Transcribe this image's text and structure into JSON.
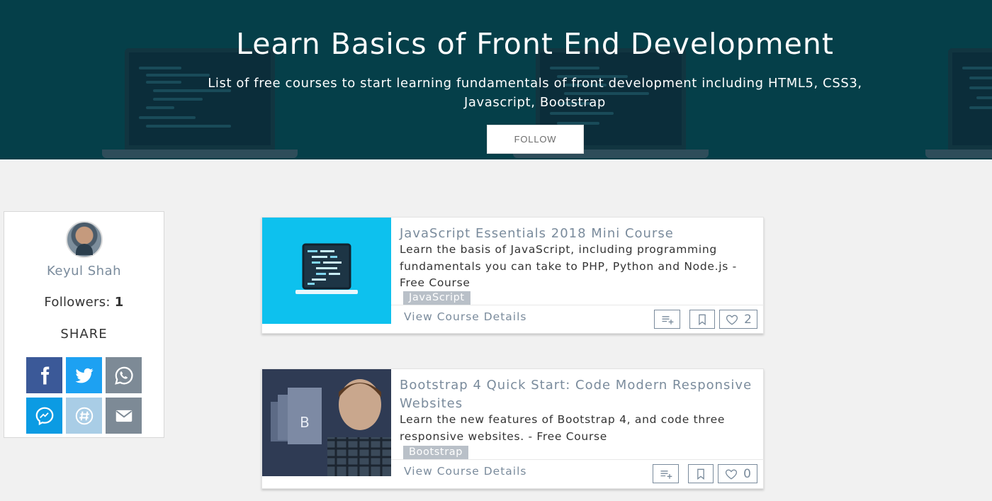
{
  "hero": {
    "title": "Learn Basics of Front End Development",
    "subtitle": "List of free courses to start learning fundamentals of front development including HTML5, CSS3, Javascript, Bootstrap",
    "follow_label": "FOLLOW",
    "background_color": "#053f49"
  },
  "profile": {
    "name": "Keyul Shah",
    "followers_label": "Followers:",
    "followers_count": "1",
    "share_label": "SHARE",
    "share_buttons": [
      {
        "network": "facebook",
        "icon": "facebook-icon",
        "color": "#3b5998"
      },
      {
        "network": "twitter",
        "icon": "twitter-icon",
        "color": "#1da1f2"
      },
      {
        "network": "whatsapp",
        "icon": "whatsapp-icon",
        "color": "#7d8a96"
      },
      {
        "network": "messenger",
        "icon": "messenger-icon",
        "color": "#0b9be3"
      },
      {
        "network": "slack",
        "icon": "slack-icon",
        "color": "#a9cde6"
      },
      {
        "network": "email",
        "icon": "email-icon",
        "color": "#7d8a96"
      }
    ]
  },
  "courses": [
    {
      "title": "JavaScript Essentials 2018 Mini Course",
      "description": "Learn the basis of JavaScript, including programming fundamentals you can take to PHP, Python and Node.js - Free Course",
      "tag": "JavaScript",
      "view_label": "View Course Details",
      "likes": "2",
      "thumb_color": "#0dc1ee"
    },
    {
      "title": "Bootstrap 4 Quick Start: Code Modern Responsive Websites",
      "description": "Learn the new features of Bootstrap 4, and code three responsive websites. - Free Course",
      "tag": "Bootstrap",
      "view_label": "View Course Details",
      "likes": "0",
      "thumb_color": "#3c4a66"
    }
  ]
}
